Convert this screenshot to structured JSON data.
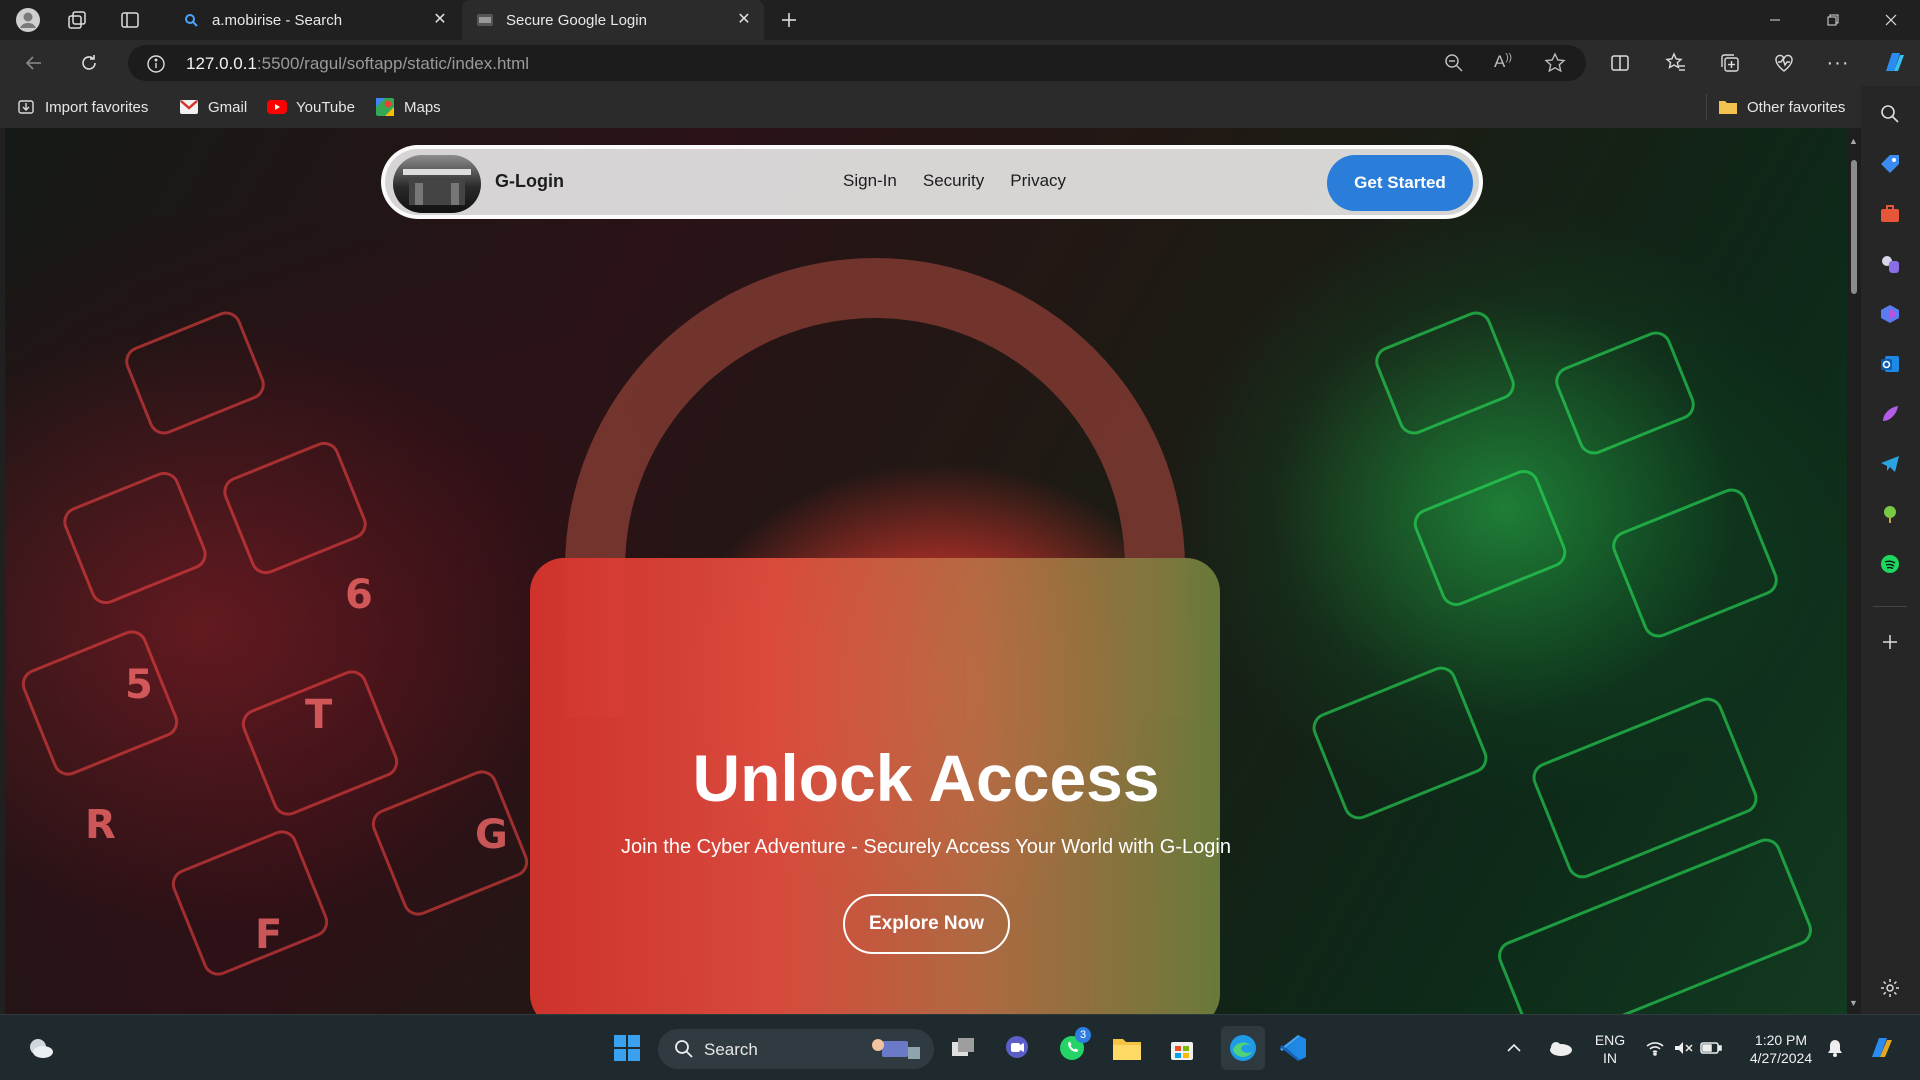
{
  "browser": {
    "tabs": [
      {
        "title": "a.mobirise - Search",
        "active": false
      },
      {
        "title": "Secure Google Login",
        "active": true
      }
    ],
    "address": {
      "host": "127.0.0.1",
      "rest": ":5500/ragul/softapp/static/index.html"
    },
    "favorites": [
      {
        "label": "Import favorites",
        "icon": "import-icon"
      },
      {
        "label": "Gmail",
        "icon": "gmail-icon"
      },
      {
        "label": "YouTube",
        "icon": "youtube-icon"
      },
      {
        "label": "Maps",
        "icon": "maps-icon"
      }
    ],
    "other_favorites": "Other favorites"
  },
  "site": {
    "brand": "G-Login",
    "nav": [
      "Sign-In",
      "Security",
      "Privacy"
    ],
    "cta": "Get Started",
    "hero_title": "Unlock Access",
    "hero_subtitle": "Join the Cyber Adventure - Securely Access Your World with G-Login",
    "hero_button": "Explore Now"
  },
  "taskbar": {
    "search_label": "Search",
    "whatsapp_badge": "3",
    "lang_top": "ENG",
    "lang_bottom": "IN",
    "time": "1:20 PM",
    "date": "4/27/2024"
  },
  "colors": {
    "accent": "#2a7ed9",
    "tab_bg": "#202020",
    "toolbar_bg": "#2b2b2b"
  }
}
